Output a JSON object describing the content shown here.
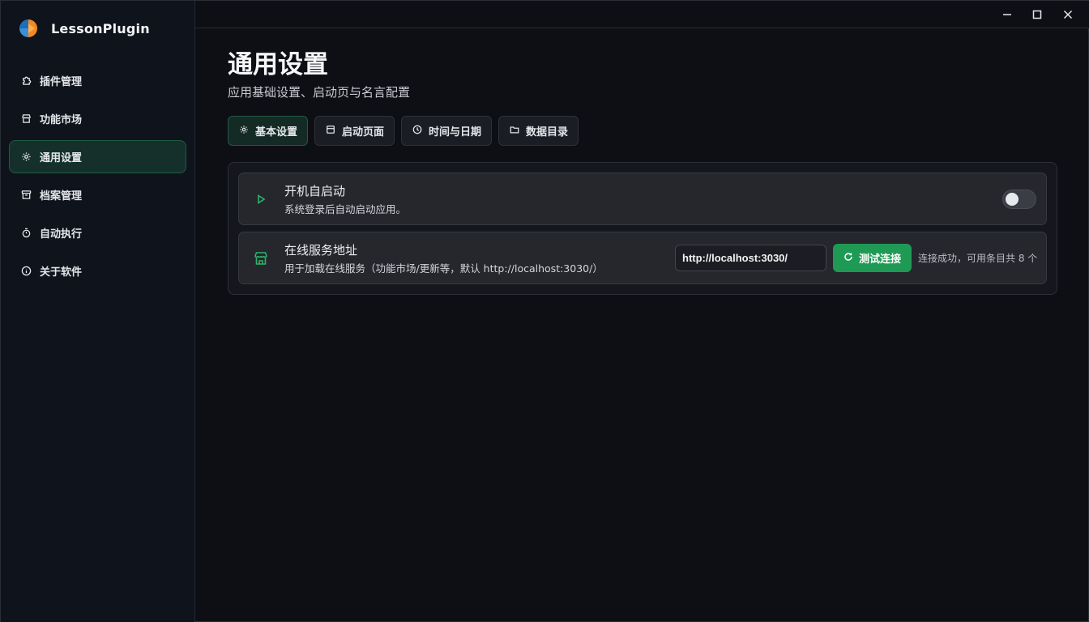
{
  "app": {
    "name": "LessonPlugin"
  },
  "sidebar": {
    "items": [
      {
        "label": "插件管理",
        "icon": "puzzle-icon"
      },
      {
        "label": "功能市场",
        "icon": "store-icon"
      },
      {
        "label": "通用设置",
        "icon": "gear-icon",
        "active": true
      },
      {
        "label": "档案管理",
        "icon": "archive-icon"
      },
      {
        "label": "自动执行",
        "icon": "timer-icon"
      },
      {
        "label": "关于软件",
        "icon": "info-icon"
      }
    ]
  },
  "window_controls": [
    "minimize-icon",
    "maximize-icon",
    "close-icon"
  ],
  "page": {
    "title": "通用设置",
    "subtitle": "应用基础设置、启动页与名言配置"
  },
  "tabs": [
    {
      "label": "基本设置",
      "icon": "gear-icon",
      "active": true
    },
    {
      "label": "启动页面",
      "icon": "window-icon"
    },
    {
      "label": "时间与日期",
      "icon": "clock-icon"
    },
    {
      "label": "数据目录",
      "icon": "folder-icon"
    }
  ],
  "settings": {
    "autostart": {
      "title": "开机自启动",
      "description": "系统登录后自动启动应用。",
      "enabled": false,
      "icon": "play-icon"
    },
    "service": {
      "title": "在线服务地址",
      "description": "用于加载在线服务（功能市场/更新等，默认 http://localhost:3030/）",
      "url_value": "http://localhost:3030/",
      "test_button_label": "测试连接",
      "status": "连接成功，可用条目共 8 个",
      "icon": "store-icon"
    }
  },
  "colors": {
    "accent": "#1f9a54",
    "active_bg": "#15302a",
    "active_border": "#1f5a45",
    "icon_green": "#2fb36a"
  }
}
